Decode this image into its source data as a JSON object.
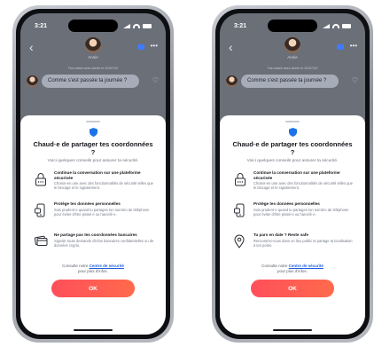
{
  "colors": {
    "accent": "#ff5a55",
    "link": "#1f5fe0",
    "shield": "#1e73e8"
  },
  "phones": [
    {
      "status_time": "3:21",
      "contact_name": "Annie",
      "match_text": "Tra match avec Annie le 20/07/22",
      "message": "Comme s'est passée ta journée ?",
      "title": "Chaud·e de partager tes coordonnées ?",
      "subtitle": "Voici quelques conseils pour assurer ta sécurité.",
      "tips": [
        {
          "icon": "lock-chat-icon",
          "title": "Continue la conversation sur une plateforme sécurisée",
          "desc": "Choisis-en une avec des fonctionnalités de sécurité telles que le blocage et le signalement."
        },
        {
          "icon": "phone-icon",
          "title": "Protège tes données personnelles",
          "desc": "Sois prudent·e quand tu partages ton numéro de téléphone pour éviter d'être piraté·e ou harcelé·e."
        },
        {
          "icon": "credit-card-icon",
          "title": "Ne partage pas tes coordonnées bancaires",
          "desc": "Signale toute demande d'infos bancaires confidentielles ou de données crypto."
        }
      ],
      "footer_prefix": "Consulte notre",
      "footer_link": "Centre de sécurité",
      "footer_suffix": "pour plus d'infos.",
      "ok_label": "OK"
    },
    {
      "status_time": "3:21",
      "contact_name": "Annie",
      "match_text": "Tra match avec Annie le 20/07/22",
      "message": "Comme s'est passée ta journée ?",
      "title": "Chaud·e de partager tes coordonnées ?",
      "subtitle": "Voici quelques conseils pour assurer ta sécurité.",
      "tips": [
        {
          "icon": "lock-chat-icon",
          "title": "Continue la conversation sur une plateforme sécurisée",
          "desc": "Choisis-en une avec des fonctionnalités de sécurité telles que le blocage et le signalement."
        },
        {
          "icon": "phone-icon",
          "title": "Protège tes données personnelles",
          "desc": "Sois prudent·e quand tu partages ton numéro de téléphone pour éviter d'être piraté·e ou harcelé·e."
        },
        {
          "icon": "location-pin-icon",
          "title": "Tu pars en date ? Reste safe",
          "desc": "Rencontrez-vous dans un lieu public et partage ta localisation à tes potes."
        }
      ],
      "footer_prefix": "Consulte notre",
      "footer_link": "Centre de sécurité",
      "footer_suffix": "pour plus d'infos.",
      "ok_label": "OK"
    }
  ]
}
